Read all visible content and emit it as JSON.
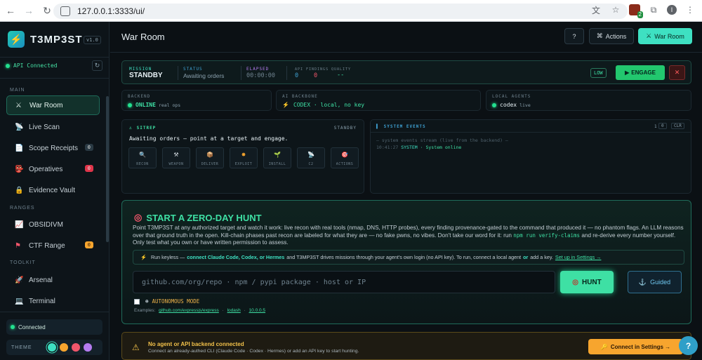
{
  "browser": {
    "url": "127.0.0.1:3333/ui/",
    "profile_initial": "I",
    "ext_count": "2"
  },
  "sidebar": {
    "brand": "T3MP3ST",
    "version": "v1.0",
    "api_status": "API Connected",
    "sections": {
      "main": "MAIN",
      "ranges": "RANGES",
      "toolkit": "TOOLKIT"
    },
    "items": [
      {
        "label": "War Room",
        "icon": "swords-icon",
        "active": true
      },
      {
        "label": "Live Scan",
        "icon": "sensor-icon"
      },
      {
        "label": "Scope Receipts",
        "icon": "document-icon",
        "badge": "0"
      },
      {
        "label": "Operatives",
        "icon": "mask-icon",
        "badge": "0"
      },
      {
        "label": "Evidence Vault",
        "icon": "lock-icon"
      },
      {
        "label": "OBSIDIVM",
        "icon": "chart-icon"
      },
      {
        "label": "CTF Range",
        "icon": "flag-icon",
        "badge": "0"
      },
      {
        "label": "Arsenal",
        "icon": "rocket-icon"
      },
      {
        "label": "Terminal",
        "icon": "laptop-icon"
      }
    ],
    "connection": "Connected",
    "theme_label": "THEME",
    "theme_colors": [
      "#3ee0c2",
      "#f7a52e",
      "#f0566b",
      "#b57cf0"
    ]
  },
  "header": {
    "title": "War Room",
    "help": "?",
    "actions": "Actions",
    "war_room": "War Room"
  },
  "mission": {
    "mission_label": "MISSION",
    "mission_value": "STANDBY",
    "status_label": "STATUS",
    "status_value": "Awaiting orders",
    "elapsed_label": "ELAPSED",
    "elapsed_value": "00:00:00",
    "api_label": "API",
    "api_value": "0",
    "findings_label": "FINDINGS",
    "findings_value": "0",
    "quality_label": "QUALITY",
    "quality_value": "--",
    "risk": "LOW",
    "engage": "ENGAGE",
    "abort": "✕"
  },
  "backends": {
    "backend_label": "BACKEND",
    "backend_state": "ONLINE",
    "backend_note": "real ops",
    "ai_label": "AI BACKBONE",
    "ai_value": "CODEX · local, no key",
    "agents_label": "LOCAL AGENTS",
    "agents_name": "codex",
    "agents_state": "live"
  },
  "sitrep": {
    "title": "SITREP",
    "state": "STANDBY",
    "message": "Awaiting orders — point at a target and engage.",
    "phases": [
      {
        "label": "RECON",
        "icon": "magnifier-icon"
      },
      {
        "label": "WEAPON",
        "icon": "hammer-icon"
      },
      {
        "label": "DELIVER",
        "icon": "package-icon"
      },
      {
        "label": "EXPLOIT",
        "icon": "bomb-icon"
      },
      {
        "label": "INSTALL",
        "icon": "plant-icon"
      },
      {
        "label": "C2",
        "icon": "antenna-icon"
      },
      {
        "label": "ACTIONS",
        "icon": "target-icon"
      }
    ]
  },
  "events": {
    "title": "SYSTEM EVENTS",
    "count": "1",
    "count_box": "0",
    "clear": "CLR",
    "stream_note": "— system events stream (live from the backend) —",
    "entry_time": "10:41:27",
    "entry_source": "SYSTEM",
    "entry_text": "· System online"
  },
  "hunt": {
    "title": "START A ZERO-DAY HUNT",
    "desc_main": "Point T3MP3ST at any authorized target and watch it work: live recon with real tools (nmap, DNS, HTTP probes), every finding provenance-gated to the command that produced it — no phantom flags. An LLM reasons over that ground truth in the open. Kill-chain phases past recon are labeled for what they are — no fake pwns, no vibes. Don't take our word for it: run",
    "desc_code": "npm run verify-claims",
    "desc_tail": "and re-derive every number yourself. Only test what you own or have written permission to assess.",
    "keyless_lead": "Run keyless —",
    "keyless_bold": "connect Claude Code, Codex, or Hermes",
    "keyless_text": "and T3MP3ST drives missions through your agent's own login (no API key). To run, connect a local agent",
    "keyless_or": "or",
    "keyless_tail": "add a key.",
    "keyless_link": "Set up in Settings →",
    "input_placeholder": "github.com/org/repo   ·   npm / pypi package   ·   host or IP",
    "hunt_button": "HUNT",
    "guided_button": "Guided",
    "autonomous": "AUTONOMOUS MODE",
    "examples_label": "Examples:",
    "examples": [
      "github.com/expressjs/express",
      "lodash",
      "10.0.0.5"
    ]
  },
  "warning": {
    "title": "No agent or API backend connected",
    "subtitle": "Connect an already-authed CLI (Claude Code · Codex · Hermes) or add an API key to start hunting.",
    "button": "Connect in Settings →",
    "help_fab": "?"
  }
}
